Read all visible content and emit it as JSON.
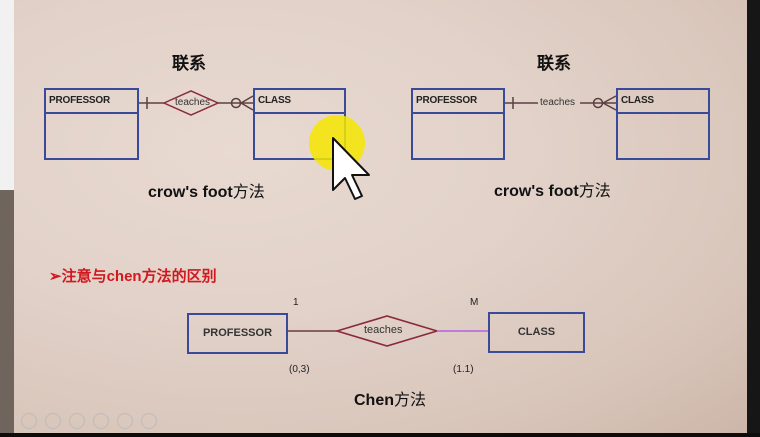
{
  "left_diagram": {
    "title": "联系",
    "entity_a": "PROFESSOR",
    "relationship": "teaches",
    "entity_b": "CLASS",
    "caption_latin": "crow's foot",
    "caption_cn": "方法"
  },
  "right_diagram": {
    "title": "联系",
    "entity_a": "PROFESSOR",
    "relationship": "teaches",
    "entity_b": "CLASS",
    "caption_latin": "crow's foot",
    "caption_cn": "方法"
  },
  "note": "➢注意与chen方法的区别",
  "chen_diagram": {
    "entity_a": "PROFESSOR",
    "relationship": "teaches",
    "entity_b": "CLASS",
    "card_a": "1",
    "card_b": "M",
    "range_a": "(0,3)",
    "range_b": "(1.1)",
    "caption_latin": "Chen",
    "caption_cn": "方法"
  },
  "colors": {
    "entity_border": "#3a4a9a",
    "relationship_border": "#8a2a3a",
    "highlight_line": "#c07ad8",
    "note_text": "#d1181e",
    "pointer_highlight": "#f5e600"
  }
}
